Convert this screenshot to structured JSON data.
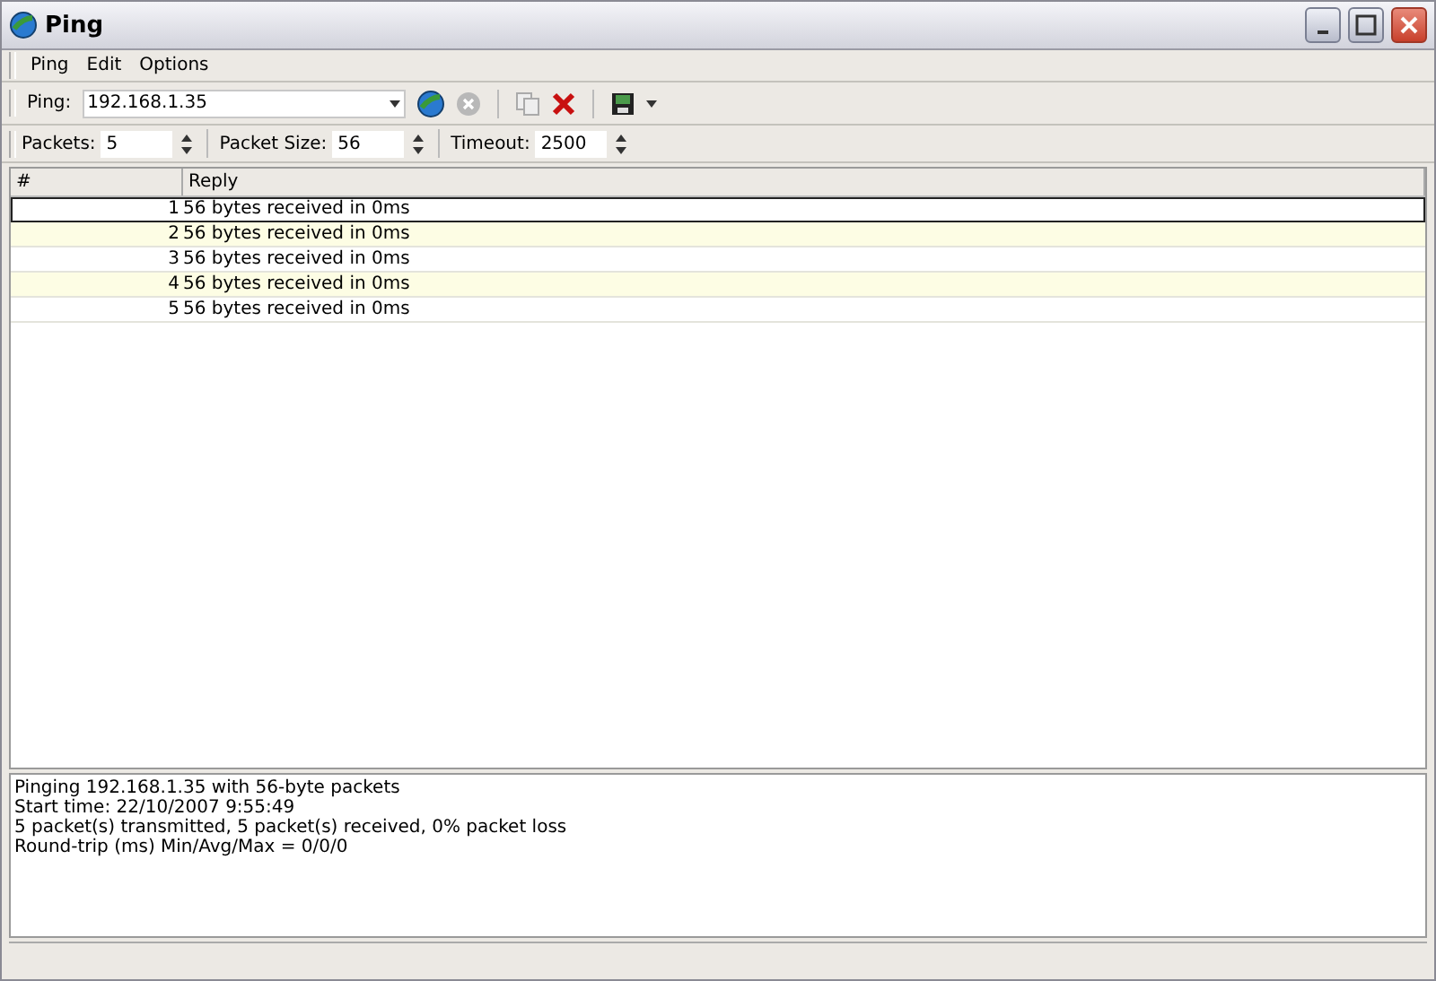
{
  "window": {
    "title": "Ping"
  },
  "menu": [
    "Ping",
    "Edit",
    "Options"
  ],
  "toolbar": {
    "label": "Ping:",
    "value": "192.168.1.35"
  },
  "options": [
    {
      "label": "Packets:",
      "value": "5"
    },
    {
      "label": "Packet Size:",
      "value": "56"
    },
    {
      "label": "Timeout:",
      "value": "2500"
    }
  ],
  "table": {
    "columns": [
      "#",
      "Reply"
    ],
    "rows": [
      {
        "n": "1",
        "reply": "56 bytes received in 0ms",
        "selected": true
      },
      {
        "n": "2",
        "reply": "56 bytes received in 0ms",
        "selected": false
      },
      {
        "n": "3",
        "reply": "56 bytes received in 0ms",
        "selected": false
      },
      {
        "n": "4",
        "reply": "56 bytes received in 0ms",
        "selected": false
      },
      {
        "n": "5",
        "reply": "56 bytes received in 0ms",
        "selected": false
      }
    ]
  },
  "log": [
    "Pinging 192.168.1.35 with 56-byte packets",
    "Start time: 22/10/2007 9:55:49",
    "5 packet(s) transmitted, 5 packet(s) received, 0% packet loss",
    "Round-trip (ms) Min/Avg/Max = 0/0/0"
  ]
}
